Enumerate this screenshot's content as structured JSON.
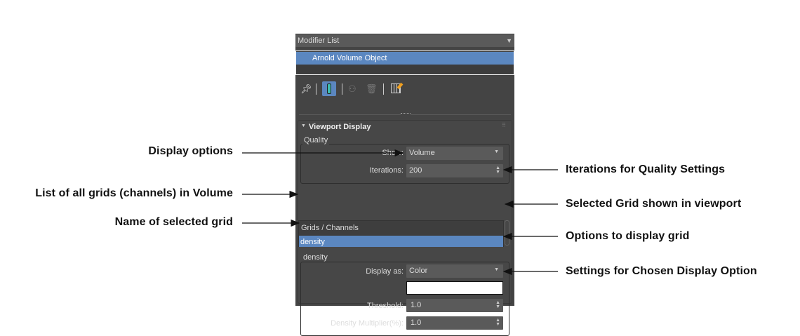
{
  "panel": {
    "modifier_list": "Modifier List",
    "stack": [
      "Arnold Volume Object"
    ],
    "toolbar": [
      "pin-stack-icon",
      "show-end-result-icon",
      "make-unique-icon",
      "remove-modifier-icon",
      "configure-modifier-sets-icon"
    ],
    "rollout_title": "Viewport Display",
    "quality": {
      "group": "Quality",
      "show_label": "Show:",
      "show_value": "Volume",
      "iterations_label": "Iterations:",
      "iterations_value": "200"
    },
    "grids": {
      "header": "Grids / Channels",
      "items": [
        "density"
      ]
    },
    "grid_settings": {
      "group": "density",
      "display_as_label": "Display as:",
      "display_as_value": "Color",
      "color": "#ffffff",
      "threshold_label": "Threshold:",
      "threshold_value": "1.0",
      "density_label": "Density Multiplier(%):",
      "density_value": "1.0"
    }
  },
  "annotations": {
    "display_options": "Display options",
    "list_grids": "List of all grids (channels) in Volume",
    "name_grid": "Name of selected grid",
    "iterations": "Iterations for Quality Settings",
    "selected_grid": "Selected Grid shown in viewport",
    "display_grid": "Options to display grid",
    "settings": "Settings for Chosen Display Option"
  },
  "colors": {
    "panel": "#444444",
    "selection": "#5b87c0",
    "field": "#5a5a5a"
  }
}
